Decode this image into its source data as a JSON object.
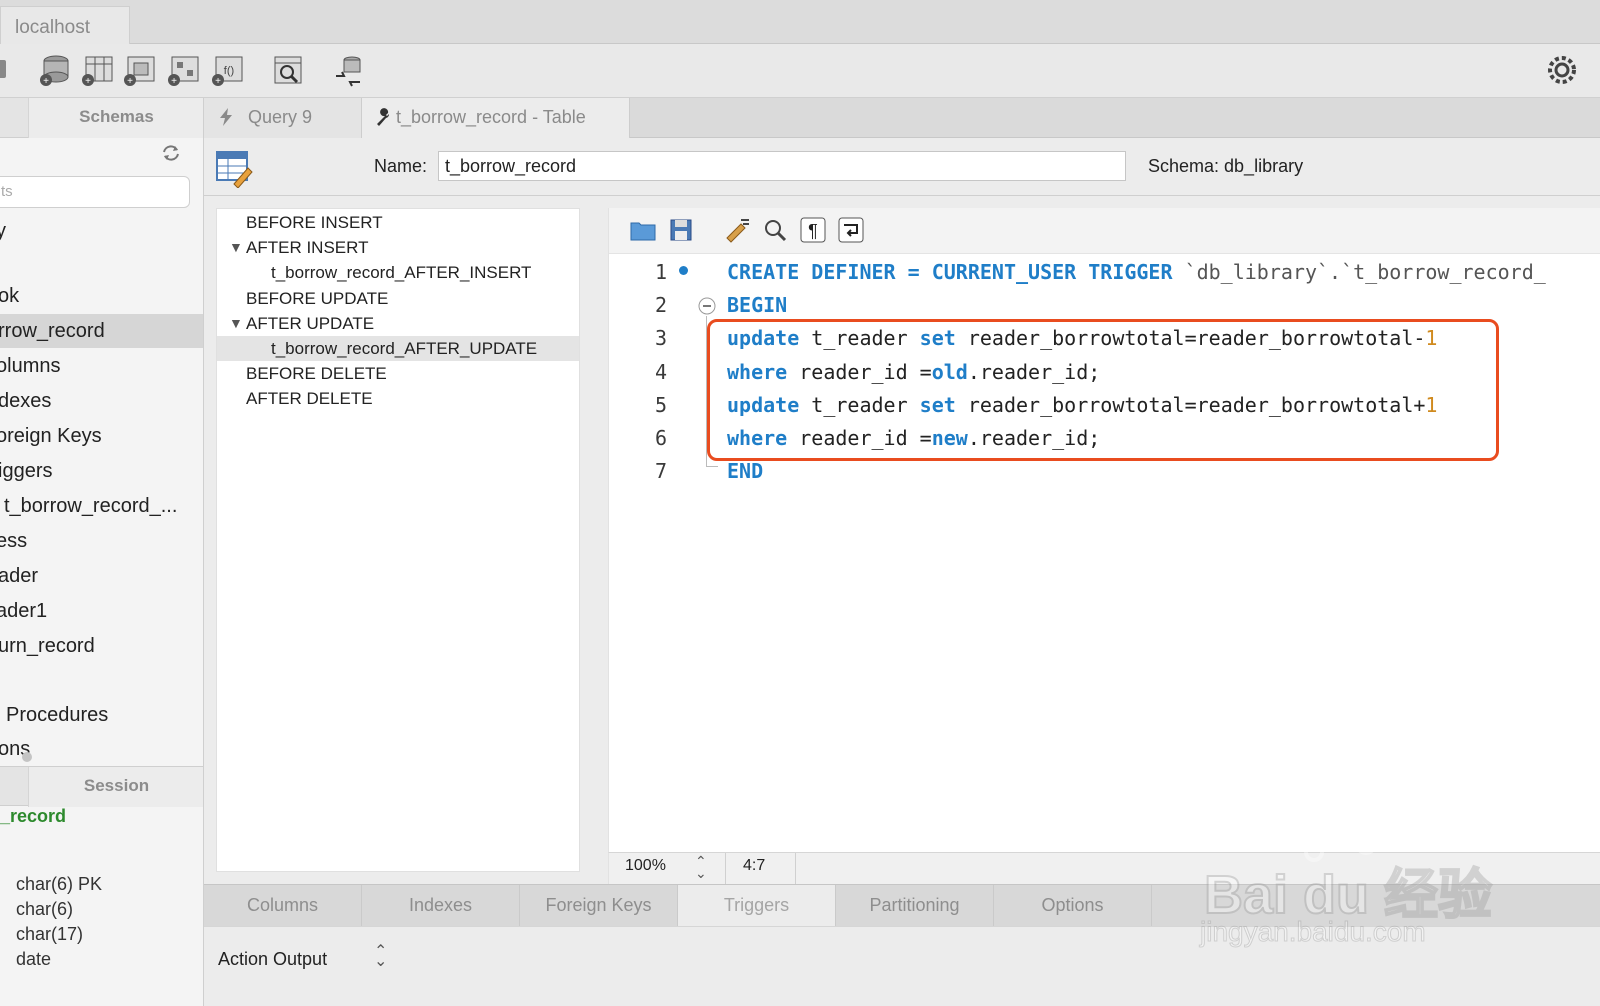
{
  "window": {
    "host_tab": "localhost"
  },
  "toolbar": {
    "buttons": [
      "new-connection-icon",
      "create-schema-icon",
      "create-table-icon",
      "create-view-icon",
      "create-procedure-icon",
      "create-function-icon",
      "inspect-icon",
      "reconnect-icon",
      "settings-icon"
    ]
  },
  "sidebar": {
    "schemas_tab": "Schemas",
    "search_placeholder": "ts",
    "items": [
      {
        "label": "y",
        "selected": false
      },
      {
        "label": "ok",
        "selected": false
      },
      {
        "label": "rrow_record",
        "selected": true
      },
      {
        "label": "olumns",
        "selected": false
      },
      {
        "label": "dexes",
        "selected": false
      },
      {
        "label": "oreign Keys",
        "selected": false
      },
      {
        "label": "iggers",
        "selected": false
      },
      {
        "label": "t_borrow_record_...",
        "selected": false
      },
      {
        "label": "ess",
        "selected": false
      },
      {
        "label": "ader",
        "selected": false
      },
      {
        "label": "ader1",
        "selected": false
      },
      {
        "label": "urn_record",
        "selected": false
      },
      {
        "label": "Procedures",
        "selected": false
      },
      {
        "label": "ons",
        "selected": false
      }
    ],
    "session_tab": "Session",
    "info_title": "_record",
    "info_lines": [
      "char(6) PK",
      "char(6)",
      "char(17)",
      "date"
    ]
  },
  "editor_tabs": [
    {
      "label": "Query 9",
      "icon": "lightning-icon"
    },
    {
      "label": "t_borrow_record - Table",
      "icon": "wrench-icon"
    }
  ],
  "header": {
    "name_label": "Name:",
    "name_value": "t_borrow_record",
    "schema_label": "Schema:  db_library"
  },
  "triggers": [
    {
      "label": "BEFORE INSERT",
      "level": 0,
      "expanded": false,
      "selected": false
    },
    {
      "label": "AFTER INSERT",
      "level": 0,
      "expanded": true,
      "selected": false
    },
    {
      "label": "t_borrow_record_AFTER_INSERT",
      "level": 1,
      "expanded": false,
      "selected": false
    },
    {
      "label": "BEFORE UPDATE",
      "level": 0,
      "expanded": false,
      "selected": false
    },
    {
      "label": "AFTER UPDATE",
      "level": 0,
      "expanded": true,
      "selected": false
    },
    {
      "label": "t_borrow_record_AFTER_UPDATE",
      "level": 1,
      "expanded": false,
      "selected": true
    },
    {
      "label": "BEFORE DELETE",
      "level": 0,
      "expanded": false,
      "selected": false
    },
    {
      "label": "AFTER DELETE",
      "level": 0,
      "expanded": false,
      "selected": false
    }
  ],
  "code": {
    "lines": [
      [
        {
          "t": "CREATE DEFINER = CURRENT_USER TRIGGER ",
          "c": "kw"
        },
        {
          "t": "`db_library`.`t_borrow_record_",
          "c": "str"
        }
      ],
      [
        {
          "t": "BEGIN",
          "c": "kw"
        }
      ],
      [
        {
          "t": "update",
          "c": "kw"
        },
        {
          "t": " t_reader ",
          "c": ""
        },
        {
          "t": "set",
          "c": "kw"
        },
        {
          "t": " reader_borrowtotal=reader_borrowtotal-",
          "c": ""
        },
        {
          "t": "1",
          "c": "num"
        }
      ],
      [
        {
          "t": "where",
          "c": "kw"
        },
        {
          "t": " reader_id =",
          "c": ""
        },
        {
          "t": "old",
          "c": "kw"
        },
        {
          "t": ".reader_id;",
          "c": ""
        }
      ],
      [
        {
          "t": "update",
          "c": "kw"
        },
        {
          "t": " t_reader ",
          "c": ""
        },
        {
          "t": "set",
          "c": "kw"
        },
        {
          "t": " reader_borrowtotal=reader_borrowtotal+",
          "c": ""
        },
        {
          "t": "1",
          "c": "num"
        }
      ],
      [
        {
          "t": "where",
          "c": "kw"
        },
        {
          "t": " reader_id =",
          "c": ""
        },
        {
          "t": "new",
          "c": "kw"
        },
        {
          "t": ".reader_id;",
          "c": ""
        }
      ],
      [
        {
          "t": "END",
          "c": "kw"
        }
      ]
    ],
    "line_numbers": [
      "1",
      "2",
      "3",
      "4",
      "5",
      "6",
      "7"
    ]
  },
  "status": {
    "zoom": "100%",
    "cursor": "4:7"
  },
  "bottom_tabs": [
    {
      "label": "Columns",
      "active": false
    },
    {
      "label": "Indexes",
      "active": false
    },
    {
      "label": "Foreign Keys",
      "active": false
    },
    {
      "label": "Triggers",
      "active": true
    },
    {
      "label": "Partitioning",
      "active": false
    },
    {
      "label": "Options",
      "active": false
    }
  ],
  "action": {
    "label": "Action Output"
  },
  "watermark": {
    "brand": "Bai du 经验",
    "url": "jingyan.baidu.com"
  },
  "colors": {
    "keyword": "#1f7ec8",
    "number": "#d08a1e",
    "highlight": "#e94c1f"
  }
}
